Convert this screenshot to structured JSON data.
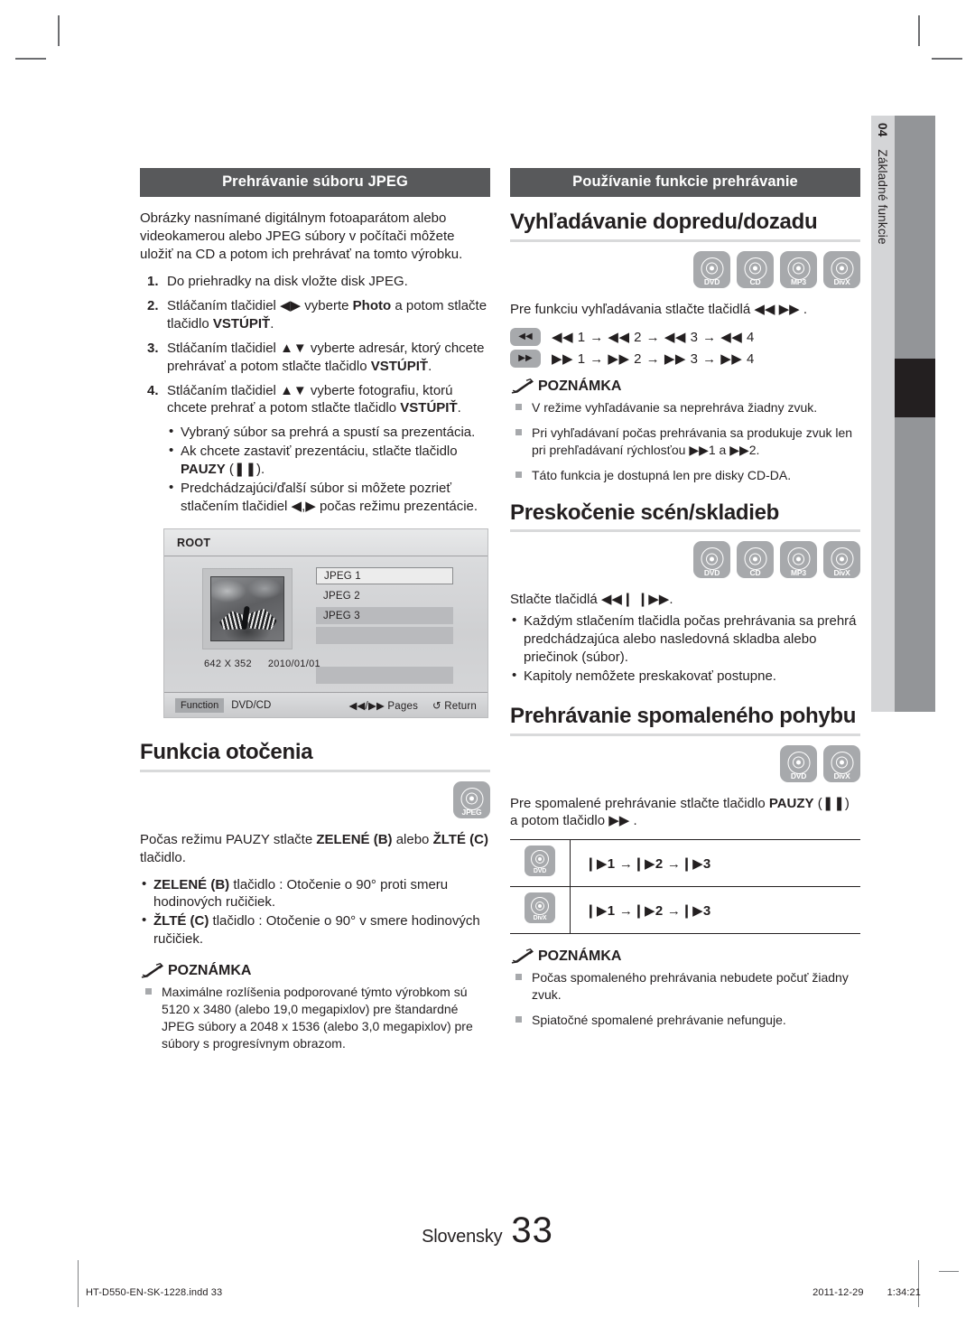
{
  "side_tab": {
    "number": "04",
    "label": "Základné funkcie"
  },
  "left_column": {
    "banner": "Prehrávanie súboru JPEG",
    "intro": "Obrázky nasnímané digitálnym fotoaparátom alebo videokamerou alebo JPEG súbory v počítači môžete uložiť na CD a potom ich prehrávať na tomto výrobku.",
    "steps": [
      {
        "num": "1.",
        "text": "Do priehradky na disk vložte disk JPEG."
      },
      {
        "num": "2.",
        "text_pre": "Stláčaním tlačidiel ",
        "arrows": "◀▶",
        "text_mid": " vyberte ",
        "bold1": "Photo",
        "text_post": " a potom stlačte tlačidlo ",
        "bold2": "VSTÚPIŤ",
        "text_end": "."
      },
      {
        "num": "3.",
        "text_pre": "Stláčaním tlačidiel ",
        "arrows": "▲▼",
        "text_mid": " vyberte adresár, ktorý chcete prehrávať a potom stlačte tlačidlo ",
        "bold2": "VSTÚPIŤ",
        "text_end": "."
      },
      {
        "num": "4.",
        "text_pre": "Stláčaním tlačidiel ",
        "arrows": "▲▼",
        "text_mid": " vyberte fotografiu, ktorú chcete prehrať a potom stlačte tlačidlo ",
        "bold2": "VSTÚPIŤ",
        "text_end": "."
      }
    ],
    "sub_bullets": [
      {
        "text": "Vybraný súbor sa prehrá a spustí sa prezentácia."
      },
      {
        "pre": "Ak chcete zastaviť prezentáciu, stlačte tlačidlo ",
        "bold": "PAUZY",
        "post": " (❚❚)."
      },
      {
        "pre": "Predchádzajúci/ďalší súbor si môžete pozrieť stlačením tlačidiel ◀,▶ počas režimu prezentácie.",
        "bold": "",
        "post": ""
      }
    ],
    "osd": {
      "title": "ROOT",
      "items": [
        {
          "label": "JPEG 1",
          "state": "selected"
        },
        {
          "label": "JPEG 2",
          "state": "plain"
        },
        {
          "label": "JPEG 3",
          "state": "shaded"
        },
        {
          "label": "",
          "state": "shaded"
        },
        {
          "label": "",
          "state": "gap"
        },
        {
          "label": "",
          "state": "shaded"
        }
      ],
      "resolution": "642 X 352",
      "date": "2010/01/01",
      "bar": {
        "function_label": "Function",
        "source": "DVD/CD",
        "pages": "◀◀/▶▶ Pages",
        "return": "↺ Return"
      }
    },
    "rotation": {
      "heading": "Funkcia otočenia",
      "icons": [
        {
          "label": "JPEG"
        }
      ],
      "intro_pre": "Počas režimu PAUZY stlačte ",
      "intro_b1": "ZELENÉ (B)",
      "intro_mid": " alebo ",
      "intro_b2": "ŽLTÉ (C)",
      "intro_post": " tlačidlo.",
      "bullets": [
        {
          "bold": "ZELENÉ (B)",
          "rest": " tlačidlo : Otočenie o 90° proti smeru hodinových ručičiek."
        },
        {
          "bold": "ŽLTÉ (C)",
          "rest": " tlačidlo : Otočenie o 90° v smere hodinových ručičiek."
        }
      ]
    },
    "note": {
      "title": "POZNÁMKA",
      "items": [
        "Maximálne rozlíšenia podporované týmto výrobkom sú 5120 x 3480 (alebo 19,0 megapixlov) pre štandardné JPEG súbory a 2048 x 1536 (alebo 3,0 megapixlov) pre súbory s progresívnym obrazom."
      ]
    }
  },
  "right_column": {
    "banner": "Používanie funkcie prehrávanie",
    "search": {
      "heading": "Vyhľadávanie dopredu/dozadu",
      "icons": [
        {
          "label": "DVD"
        },
        {
          "label": "CD"
        },
        {
          "label": "MP3"
        },
        {
          "label": "DivX"
        }
      ],
      "intro": "Pre funkciu vyhľadávania stlačte tlačidlá ◀◀ ▶▶ .",
      "speed_rows": [
        {
          "key": "◀◀",
          "sequence": "◀◀ 1 → ◀◀ 2 → ◀◀ 3 → ◀◀ 4"
        },
        {
          "key": "▶▶",
          "sequence": "▶▶ 1 → ▶▶ 2 → ▶▶ 3 → ▶▶ 4"
        }
      ],
      "note": {
        "title": "POZNÁMKA",
        "items": [
          "V režime vyhľadávanie sa neprehráva žiadny zvuk.",
          "Pri vyhľadávaní počas prehrávania sa produkuje zvuk len pri prehľadávaní rýchlosťou ▶▶1 a ▶▶2.",
          "Táto funkcia je dostupná len pre disky CD-DA."
        ]
      }
    },
    "skip": {
      "heading": "Preskočenie scén/skladieb",
      "icons": [
        {
          "label": "DVD"
        },
        {
          "label": "CD"
        },
        {
          "label": "MP3"
        },
        {
          "label": "DivX"
        }
      ],
      "intro": "Stlačte tlačidlá ◀◀❙ ❙▶▶.",
      "bullets": [
        "Každým stlačením tlačidla počas prehrávania sa prehrá predchádzajúca alebo nasledovná skladba alebo priečinok (súbor).",
        "Kapitoly nemôžete preskakovať postupne."
      ]
    },
    "slow": {
      "heading": "Prehrávanie spomaleného pohybu",
      "icons": [
        {
          "label": "DVD"
        },
        {
          "label": "DivX"
        }
      ],
      "intro_pre": "Pre spomalené prehrávanie stlačte tlačidlo ",
      "intro_b": "PAUZY",
      "intro_post": " (❚❚) a potom tlačidlo ▶▶ .",
      "table": [
        {
          "icon": "DVD",
          "sequence": "❙▶1 →❙▶2 →❙▶3"
        },
        {
          "icon": "DivX",
          "sequence": "❙▶1 →❙▶2 →❙▶3"
        }
      ],
      "note": {
        "title": "POZNÁMKA",
        "items": [
          "Počas spomaleného prehrávania nebudete počuť žiadny zvuk.",
          "Spiatočné spomalené prehrávanie nefunguje."
        ]
      }
    }
  },
  "page_footer": {
    "language": "Slovensky",
    "number": "33"
  },
  "print_footer": {
    "filename": "HT-D550-EN-SK-1228.indd   33",
    "date": "2011-12-29",
    "time": "1:34:21"
  }
}
